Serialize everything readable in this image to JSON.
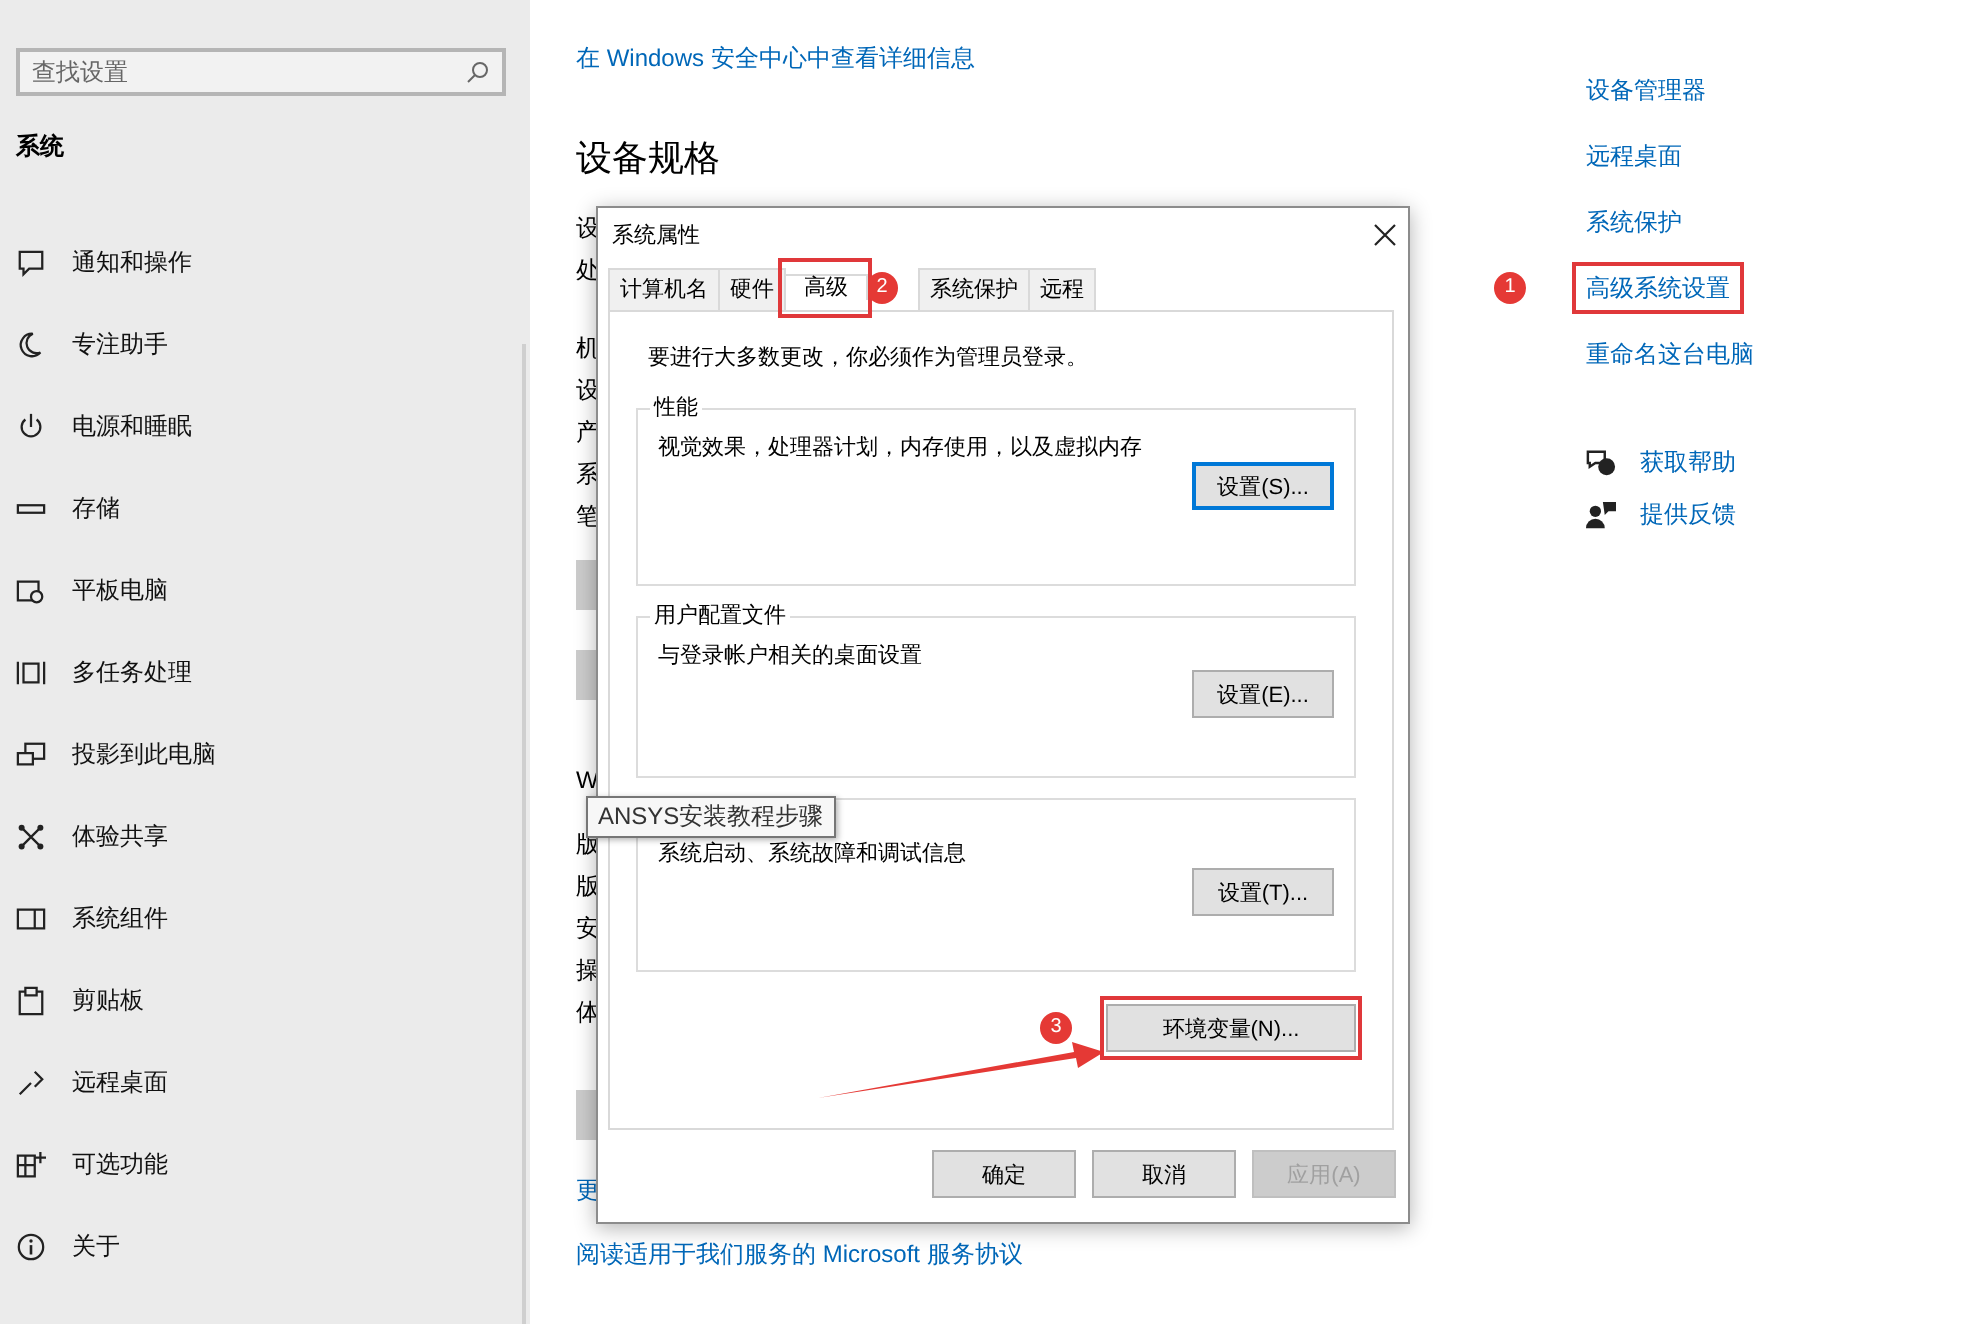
{
  "sidebar": {
    "search": {
      "placeholder": "查找设置"
    },
    "section": "系统",
    "items": [
      {
        "label": "通知和操作"
      },
      {
        "label": "专注助手"
      },
      {
        "label": "电源和睡眠"
      },
      {
        "label": "存储"
      },
      {
        "label": "平板电脑"
      },
      {
        "label": "多任务处理"
      },
      {
        "label": "投影到此电脑"
      },
      {
        "label": "体验共享"
      },
      {
        "label": "系统组件"
      },
      {
        "label": "剪贴板"
      },
      {
        "label": "远程桌面"
      },
      {
        "label": "可选功能"
      },
      {
        "label": "关于"
      }
    ]
  },
  "main": {
    "security_link": "在 Windows 安全中心中查看详细信息",
    "specs_heading": "设备规格",
    "spec_fragments": [
      "设",
      "处",
      "机",
      "设",
      "产",
      "系",
      "笔"
    ],
    "windows_heading_fragment": "W",
    "windows_fragments": [
      "版",
      "版",
      "安",
      "操",
      "体"
    ],
    "link_fragment": "更",
    "agreement_link": "阅读适用于我们服务的 Microsoft 服务协议"
  },
  "related": {
    "links": [
      {
        "label": "设备管理器",
        "highlighted": false
      },
      {
        "label": "远程桌面",
        "highlighted": false
      },
      {
        "label": "系统保护",
        "highlighted": false
      },
      {
        "label": "高级系统设置",
        "highlighted": true,
        "badge": "1"
      },
      {
        "label": "重命名这台电脑",
        "highlighted": false
      }
    ],
    "help": [
      {
        "label": "获取帮助"
      },
      {
        "label": "提供反馈"
      }
    ]
  },
  "dialog": {
    "title": "系统属性",
    "tabs": [
      {
        "label": "计算机名",
        "selected": false,
        "highlighted": false
      },
      {
        "label": "硬件",
        "selected": false,
        "highlighted": false
      },
      {
        "label": "高级",
        "selected": true,
        "highlighted": true,
        "badge": "2"
      },
      {
        "label": "系统保护",
        "selected": false,
        "highlighted": false
      },
      {
        "label": "远程",
        "selected": false,
        "highlighted": false
      }
    ],
    "admin_note": "要进行大多数更改，你必须作为管理员登录。",
    "groups": [
      {
        "title": "性能",
        "description": "视觉效果，处理器计划，内存使用，以及虚拟内存",
        "button": "设置(S)...",
        "default": true
      },
      {
        "title": "用户配置文件",
        "description": "与登录帐户相关的桌面设置",
        "button": "设置(E)...",
        "default": false
      },
      {
        "description": "系统启动、系统故障和调试信息",
        "button": "设置(T)...",
        "default": false
      }
    ],
    "env_button": {
      "label": "环境变量(N)...",
      "highlighted": true,
      "badge": "3",
      "arrow": true
    },
    "buttons": [
      {
        "label": "确定",
        "disabled": false
      },
      {
        "label": "取消",
        "disabled": false
      },
      {
        "label": "应用(A)",
        "disabled": true
      }
    ]
  },
  "tooltip": "ANSYS安装教程步骤"
}
